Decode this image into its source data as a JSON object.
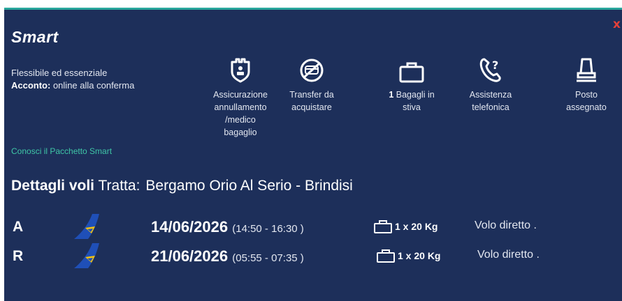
{
  "close_label": "x",
  "package": {
    "title": "Smart",
    "description": "Flessibile ed essenziale",
    "acconto_label": "Acconto:",
    "acconto_value": " online alla conferma",
    "link": "Conosci il Pacchetto Smart"
  },
  "features": [
    {
      "icon": "insurance-shield-icon",
      "lines": [
        "Assicurazione",
        "annullamento",
        "/medico",
        "bagaglio"
      ]
    },
    {
      "icon": "transfer-bus-icon",
      "lines": [
        "Transfer da",
        "acquistare"
      ]
    },
    {
      "icon": "suitcase-icon",
      "count": "1",
      "lines": [
        "Bagagli in",
        "stiva"
      ]
    },
    {
      "icon": "phone-help-icon",
      "lines": [
        "Assistenza",
        "telefonica"
      ]
    },
    {
      "icon": "seat-icon",
      "lines": [
        "Posto",
        "assegnato"
      ]
    }
  ],
  "details": {
    "label": "Dettagli voli",
    "route_label": "Tratta:",
    "route": "Bergamo Orio Al Serio - Brindisi"
  },
  "flights": [
    {
      "letter": "A",
      "date": "14/06/2026",
      "time": "(14:50 - 16:30 )",
      "baggage": "1 x 20 Kg",
      "type": "Volo diretto ."
    },
    {
      "letter": "R",
      "date": "21/06/2026",
      "time": "(05:55 - 07:35 )",
      "baggage": "1 x 20 Kg",
      "type": "Volo diretto ."
    }
  ],
  "colors": {
    "panel_bg": "#1d2f5a",
    "accent_link": "#3fc6a6",
    "close": "#e5403a",
    "logo_blue": "#1f4fb7",
    "logo_yellow": "#f3c20f"
  }
}
